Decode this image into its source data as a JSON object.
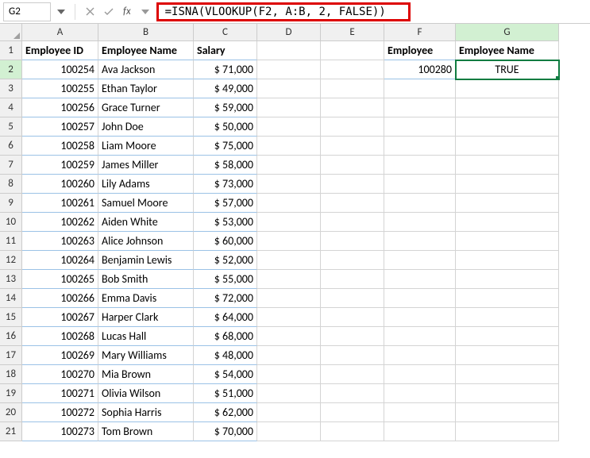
{
  "nameBox": "G2",
  "formulaBar": {
    "formula": "=ISNA(VLOOKUP(F2, A:B, 2, FALSE))"
  },
  "columns": [
    "A",
    "B",
    "C",
    "D",
    "E",
    "F",
    "G"
  ],
  "headers": {
    "A": "Employee ID",
    "B": "Employee Name",
    "C": "Salary",
    "F": "Employee",
    "G": "Employee Name"
  },
  "selectedCell": "G2",
  "lookup": {
    "F2": "100280",
    "G2": "TRUE"
  },
  "chart_data": {
    "type": "table",
    "title": "",
    "columns": [
      "Employee ID",
      "Employee Name",
      "Salary"
    ],
    "rows": [
      {
        "id": "100254",
        "name": "Ava Jackson",
        "salary": "$ 71,000"
      },
      {
        "id": "100255",
        "name": "Ethan Taylor",
        "salary": "$ 49,000"
      },
      {
        "id": "100256",
        "name": "Grace Turner",
        "salary": "$ 59,000"
      },
      {
        "id": "100257",
        "name": "John Doe",
        "salary": "$ 50,000"
      },
      {
        "id": "100258",
        "name": "Liam Moore",
        "salary": "$ 75,000"
      },
      {
        "id": "100259",
        "name": "James Miller",
        "salary": "$ 58,000"
      },
      {
        "id": "100260",
        "name": "Lily Adams",
        "salary": "$ 73,000"
      },
      {
        "id": "100261",
        "name": "Samuel Moore",
        "salary": "$ 57,000"
      },
      {
        "id": "100262",
        "name": "Aiden White",
        "salary": "$ 53,000"
      },
      {
        "id": "100263",
        "name": "Alice Johnson",
        "salary": "$ 60,000"
      },
      {
        "id": "100264",
        "name": "Benjamin Lewis",
        "salary": "$ 52,000"
      },
      {
        "id": "100265",
        "name": "Bob Smith",
        "salary": "$ 55,000"
      },
      {
        "id": "100266",
        "name": "Emma Davis",
        "salary": "$ 72,000"
      },
      {
        "id": "100267",
        "name": "Harper Clark",
        "salary": "$ 64,000"
      },
      {
        "id": "100268",
        "name": "Lucas Hall",
        "salary": "$ 68,000"
      },
      {
        "id": "100269",
        "name": "Mary Williams",
        "salary": "$ 48,000"
      },
      {
        "id": "100270",
        "name": "Mia Brown",
        "salary": "$ 54,000"
      },
      {
        "id": "100271",
        "name": "Olivia Wilson",
        "salary": "$ 51,000"
      },
      {
        "id": "100272",
        "name": "Sophia Harris",
        "salary": "$ 62,000"
      },
      {
        "id": "100273",
        "name": "Tom Brown",
        "salary": "$ 70,000"
      }
    ]
  }
}
